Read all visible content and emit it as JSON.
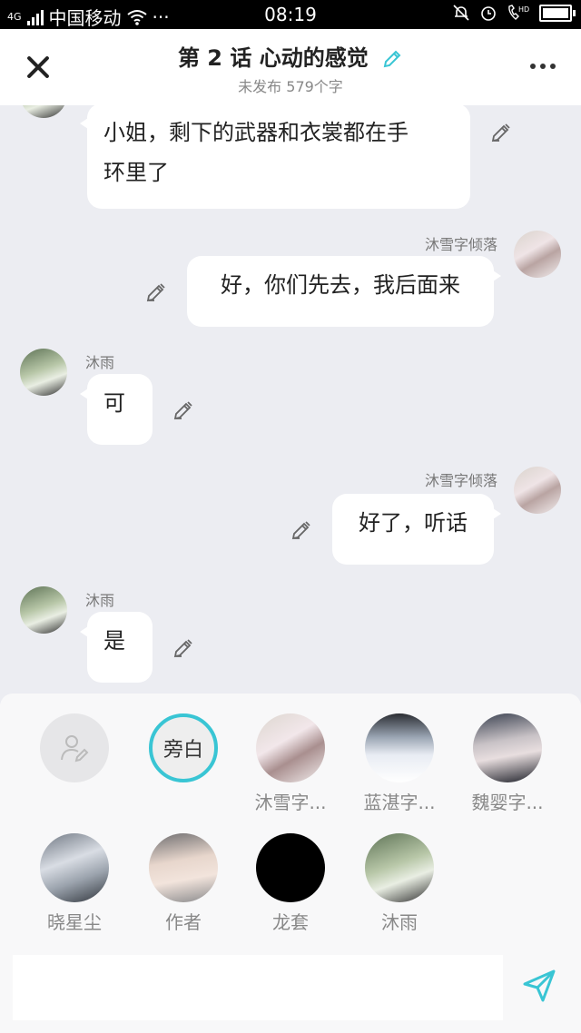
{
  "status_bar": {
    "carrier": "中国移动",
    "network": "4G",
    "time": "08:19",
    "more": "···"
  },
  "header": {
    "title": "第 2 话 心动的感觉",
    "subtitle": "未发布 579个字"
  },
  "messages": [
    {
      "side": "left",
      "sender": "",
      "text_lines": [
        "小姐，剩下的武器和衣裳都在手",
        "环里了"
      ]
    },
    {
      "side": "right",
      "sender": "沐雪字倾落",
      "text": "好，你们先去，我后面来"
    },
    {
      "side": "left",
      "sender": "沐雨",
      "text": "可"
    },
    {
      "side": "right",
      "sender": "沐雪字倾落",
      "text": "好了，听话"
    },
    {
      "side": "left",
      "sender": "沐雨",
      "text": "是"
    }
  ],
  "characters": {
    "add_icon": "person-edit-icon",
    "narrator": "旁白",
    "row1": [
      "沐雪字...",
      "蓝湛字...",
      "魏婴字..."
    ],
    "row2": [
      "晓星尘",
      "作者",
      "龙套",
      "沐雨"
    ]
  },
  "composer": {
    "value": "",
    "placeholder": "",
    "send_icon": "send-icon"
  },
  "colors": {
    "accent": "#39c5d4",
    "chat_bg": "#ecedf2"
  }
}
